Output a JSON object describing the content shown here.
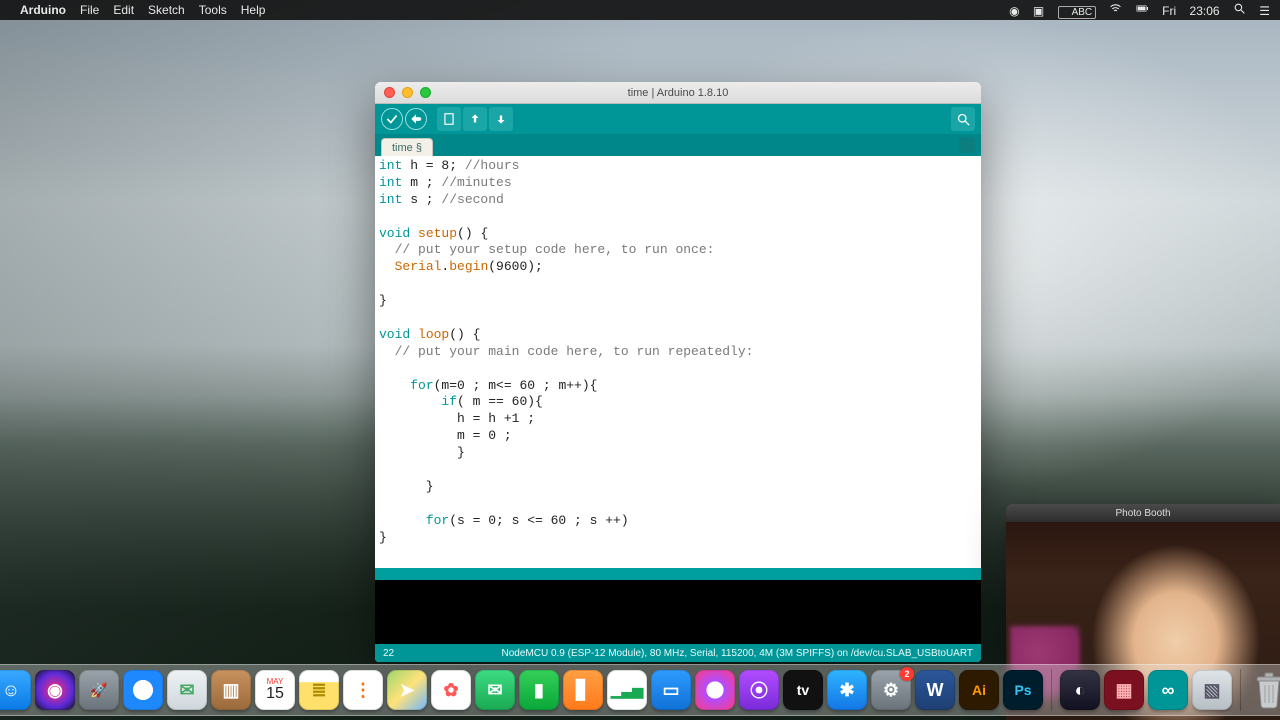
{
  "menubar": {
    "appname": "Arduino",
    "items": [
      "File",
      "Edit",
      "Sketch",
      "Tools",
      "Help"
    ],
    "right": {
      "input": "ABC",
      "day": "Fri",
      "time": "23:06"
    }
  },
  "arduino": {
    "title": "time | Arduino 1.8.10",
    "tab": "time §",
    "toolbar": {
      "verify": "verify",
      "upload": "upload",
      "new": "new",
      "open": "open",
      "save": "save",
      "serial": "serial-monitor"
    },
    "code": {
      "l1a": "int",
      "l1b": " h = 8; ",
      "l1c": "//hours",
      "l2a": "int",
      "l2b": " m ; ",
      "l2c": "//minutes",
      "l3a": "int",
      "l3b": " s ; ",
      "l3c": "//second",
      "l5a": "void",
      "l5b": " ",
      "l5c": "setup",
      "l5d": "() {",
      "l6": "  // put your setup code here, to run once:",
      "l7a": "  ",
      "l7b": "Serial",
      "l7c": ".",
      "l7d": "begin",
      "l7e": "(9600);",
      "l9": "}",
      "l11a": "void",
      "l11b": " ",
      "l11c": "loop",
      "l11d": "() {",
      "l12": "  // put your main code here, to run repeatedly:",
      "l14a": "    ",
      "l14b": "for",
      "l14c": "(m=0 ; m<= 60 ; m++){",
      "l15a": "        ",
      "l15b": "if",
      "l15c": "( m == 60){",
      "l16": "          h = h +1 ;",
      "l17": "          m = 0 ;",
      "l18": "          }",
      "l20": "      }",
      "l22a": "      ",
      "l22b": "for",
      "l22c": "(s = 0; s <= 60 ; s ++)",
      "l23": "}"
    },
    "status": {
      "line": "22",
      "board": "NodeMCU 0.9 (ESP-12 Module), 80 MHz, Serial, 115200, 4M (3M SPIFFS) on /dev/cu.SLAB_USBtoUART"
    }
  },
  "photobooth": {
    "title": "Photo Booth"
  },
  "dock": {
    "items": [
      {
        "name": "finder",
        "bg": "linear-gradient(#39a9ff,#0a7be6)",
        "glyph": "☺"
      },
      {
        "name": "siri",
        "bg": "radial-gradient(circle at 50% 50%,#ff2e7e,#5b2bd9 60%,#111)",
        "glyph": "◉"
      },
      {
        "name": "launchpad",
        "bg": "linear-gradient(#9aa3ab,#6b737a)",
        "glyph": "🚀"
      },
      {
        "name": "safari",
        "bg": "radial-gradient(circle,#fff 35%,#1e88ff 36%)",
        "glyph": "✦"
      },
      {
        "name": "mail",
        "bg": "linear-gradient(#eef2f5,#cfd6db)",
        "glyph": "✉",
        "color": "#4a6"
      },
      {
        "name": "contacts",
        "bg": "linear-gradient(#c9925e,#9a6a3b)",
        "glyph": "▥"
      },
      {
        "name": "calendar",
        "bg": "#fff",
        "glyph": "",
        "html": "<div style='font-size:8px;color:#ff3b30;line-height:1'>MAY</div><div style='font-size:16px;color:#222;line-height:1'>15</div>"
      },
      {
        "name": "notes",
        "bg": "linear-gradient(#fff 30%,#ffe06b 31%)",
        "glyph": "≣",
        "color": "#b08b00"
      },
      {
        "name": "reminders",
        "bg": "#fff",
        "glyph": "⋮",
        "color": "#ff6a00"
      },
      {
        "name": "maps",
        "bg": "linear-gradient(135deg,#9bd66b,#ffe27a 50%,#6fb7ff)",
        "glyph": "➤",
        "color": "#fff"
      },
      {
        "name": "photos",
        "bg": "#fff",
        "glyph": "✿",
        "color": "#ff5a5a"
      },
      {
        "name": "messages",
        "bg": "linear-gradient(#3ddc84,#1aa953)",
        "glyph": "✉"
      },
      {
        "name": "facetime",
        "bg": "linear-gradient(#34d058,#0aa83a)",
        "glyph": "▮",
        "color": "#fff"
      },
      {
        "name": "books",
        "bg": "linear-gradient(#ff9f43,#ff7a1a)",
        "glyph": "▋"
      },
      {
        "name": "numbers",
        "bg": "#fff",
        "glyph": "▁▃▅",
        "color": "#1aa953"
      },
      {
        "name": "keynote",
        "bg": "linear-gradient(#2e9bff,#1071d6)",
        "glyph": "▭"
      },
      {
        "name": "itunes",
        "bg": "radial-gradient(circle,#fff 30%,#b14dff 31%,#ff3b7e)",
        "glyph": "♪"
      },
      {
        "name": "podcasts",
        "bg": "linear-gradient(#b14dff,#7a2bd9)",
        "glyph": "⦿"
      },
      {
        "name": "tv",
        "bg": "#111",
        "glyph": "tv",
        "color": "#fff"
      },
      {
        "name": "appstore",
        "bg": "linear-gradient(#2eb4ff,#1376e6)",
        "glyph": "✱"
      },
      {
        "name": "preferences",
        "bg": "linear-gradient(#9aa3ab,#6b737a)",
        "glyph": "⚙",
        "badge": "2"
      },
      {
        "name": "word",
        "bg": "linear-gradient(#2b579a,#1e3f73)",
        "glyph": "W"
      },
      {
        "name": "illustrator",
        "bg": "#2d1a00",
        "glyph": "Ai",
        "color": "#ff9a00"
      },
      {
        "name": "photoshop",
        "bg": "#001d2d",
        "glyph": "Ps",
        "color": "#31c5f4"
      }
    ],
    "after_sep": [
      {
        "name": "unknown-app",
        "bg": "linear-gradient(#334,#112)",
        "glyph": "◐"
      },
      {
        "name": "media",
        "bg": "#7a1020",
        "glyph": "▦",
        "color": "#ffb0b0"
      },
      {
        "name": "arduino-ide",
        "bg": "#009698",
        "glyph": "∞"
      },
      {
        "name": "preview",
        "bg": "linear-gradient(#dfe4e8,#b7bec4)",
        "glyph": "▧",
        "color": "#556"
      }
    ],
    "trash": "trash"
  }
}
